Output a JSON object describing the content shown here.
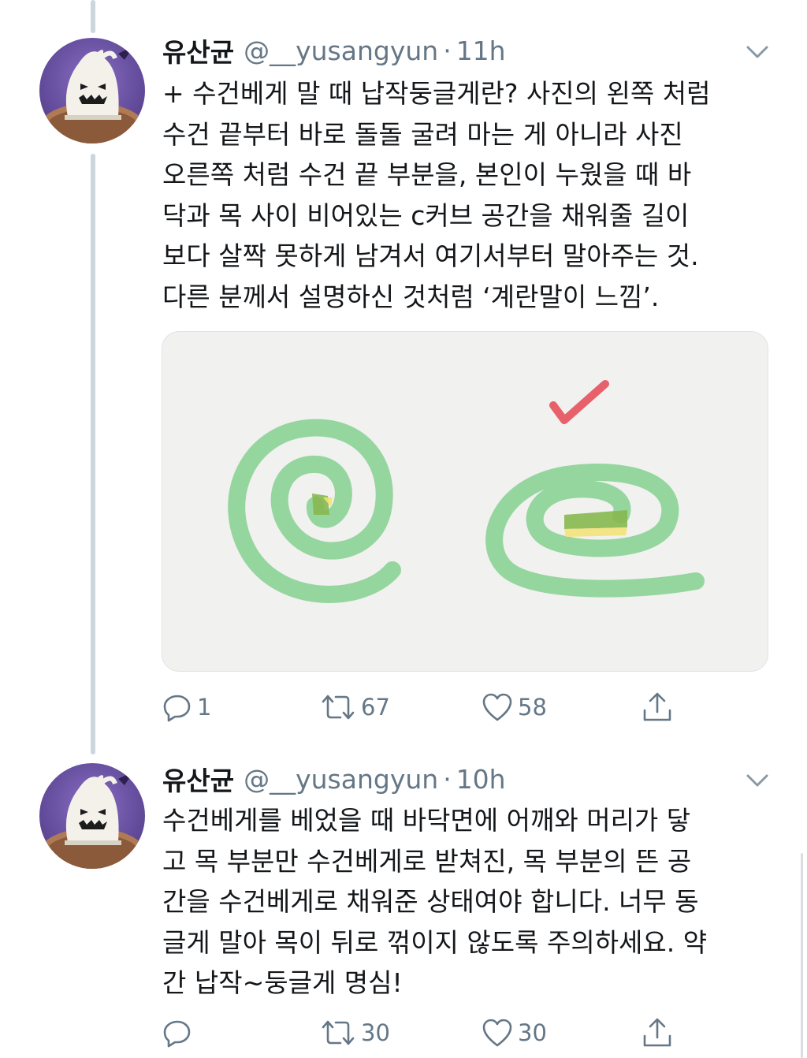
{
  "tweets": [
    {
      "display_name": "유산균",
      "handle": "@__yusangyun",
      "separator": "·",
      "time": "11h",
      "body_lines": [
        "+ 수건베게 말 때 납작둥글게란? 사진의 왼쪽 처럼",
        "수건 끝부터 바로 돌돌 굴려 마는 게 아니라 사진",
        "오른쪽 처럼 수건 끝 부분을, 본인이 누웠을 때 바",
        "닥과 목 사이 비어있는 c커브 공간을 채워줄 길이",
        "보다 살짝 못하게 남겨서 여기서부터 말아주는 것.",
        "다른 분께서 설명하신 것처럼 ‘계란말이 느낌’."
      ],
      "reply_count": "1",
      "retweet_count": "67",
      "like_count": "58"
    },
    {
      "display_name": "유산균",
      "handle": "@__yusangyun",
      "separator": "·",
      "time": "10h",
      "body_lines": [
        "수건베게를 베었을 때 바닥면에 어깨와 머리가 닿",
        "고 목 부분만 수건베게로 받쳐진, 목 부분의 뜬 공",
        "간을 수건베게로 채워준 상태여야 합니다. 너무 동",
        "글게 말아 목이 뒤로 꺾이지 않도록 주의하세요. 약",
        "간 납작~둥글게 명심!"
      ],
      "reply_count": "",
      "retweet_count": "30",
      "like_count": "30"
    }
  ],
  "icons": {
    "reply": "reply-icon",
    "retweet": "retweet-icon",
    "like": "heart-icon",
    "share": "share-icon",
    "caret": "chevron-down-icon",
    "avatar": "ghost-avatar"
  },
  "colors": {
    "text": "#14171a",
    "muted": "#657786",
    "thread_line": "#ccd6dd",
    "spiral_green": "#8fd49a",
    "accent_yellow": "#f3e27a",
    "check_red": "#e8606a"
  }
}
